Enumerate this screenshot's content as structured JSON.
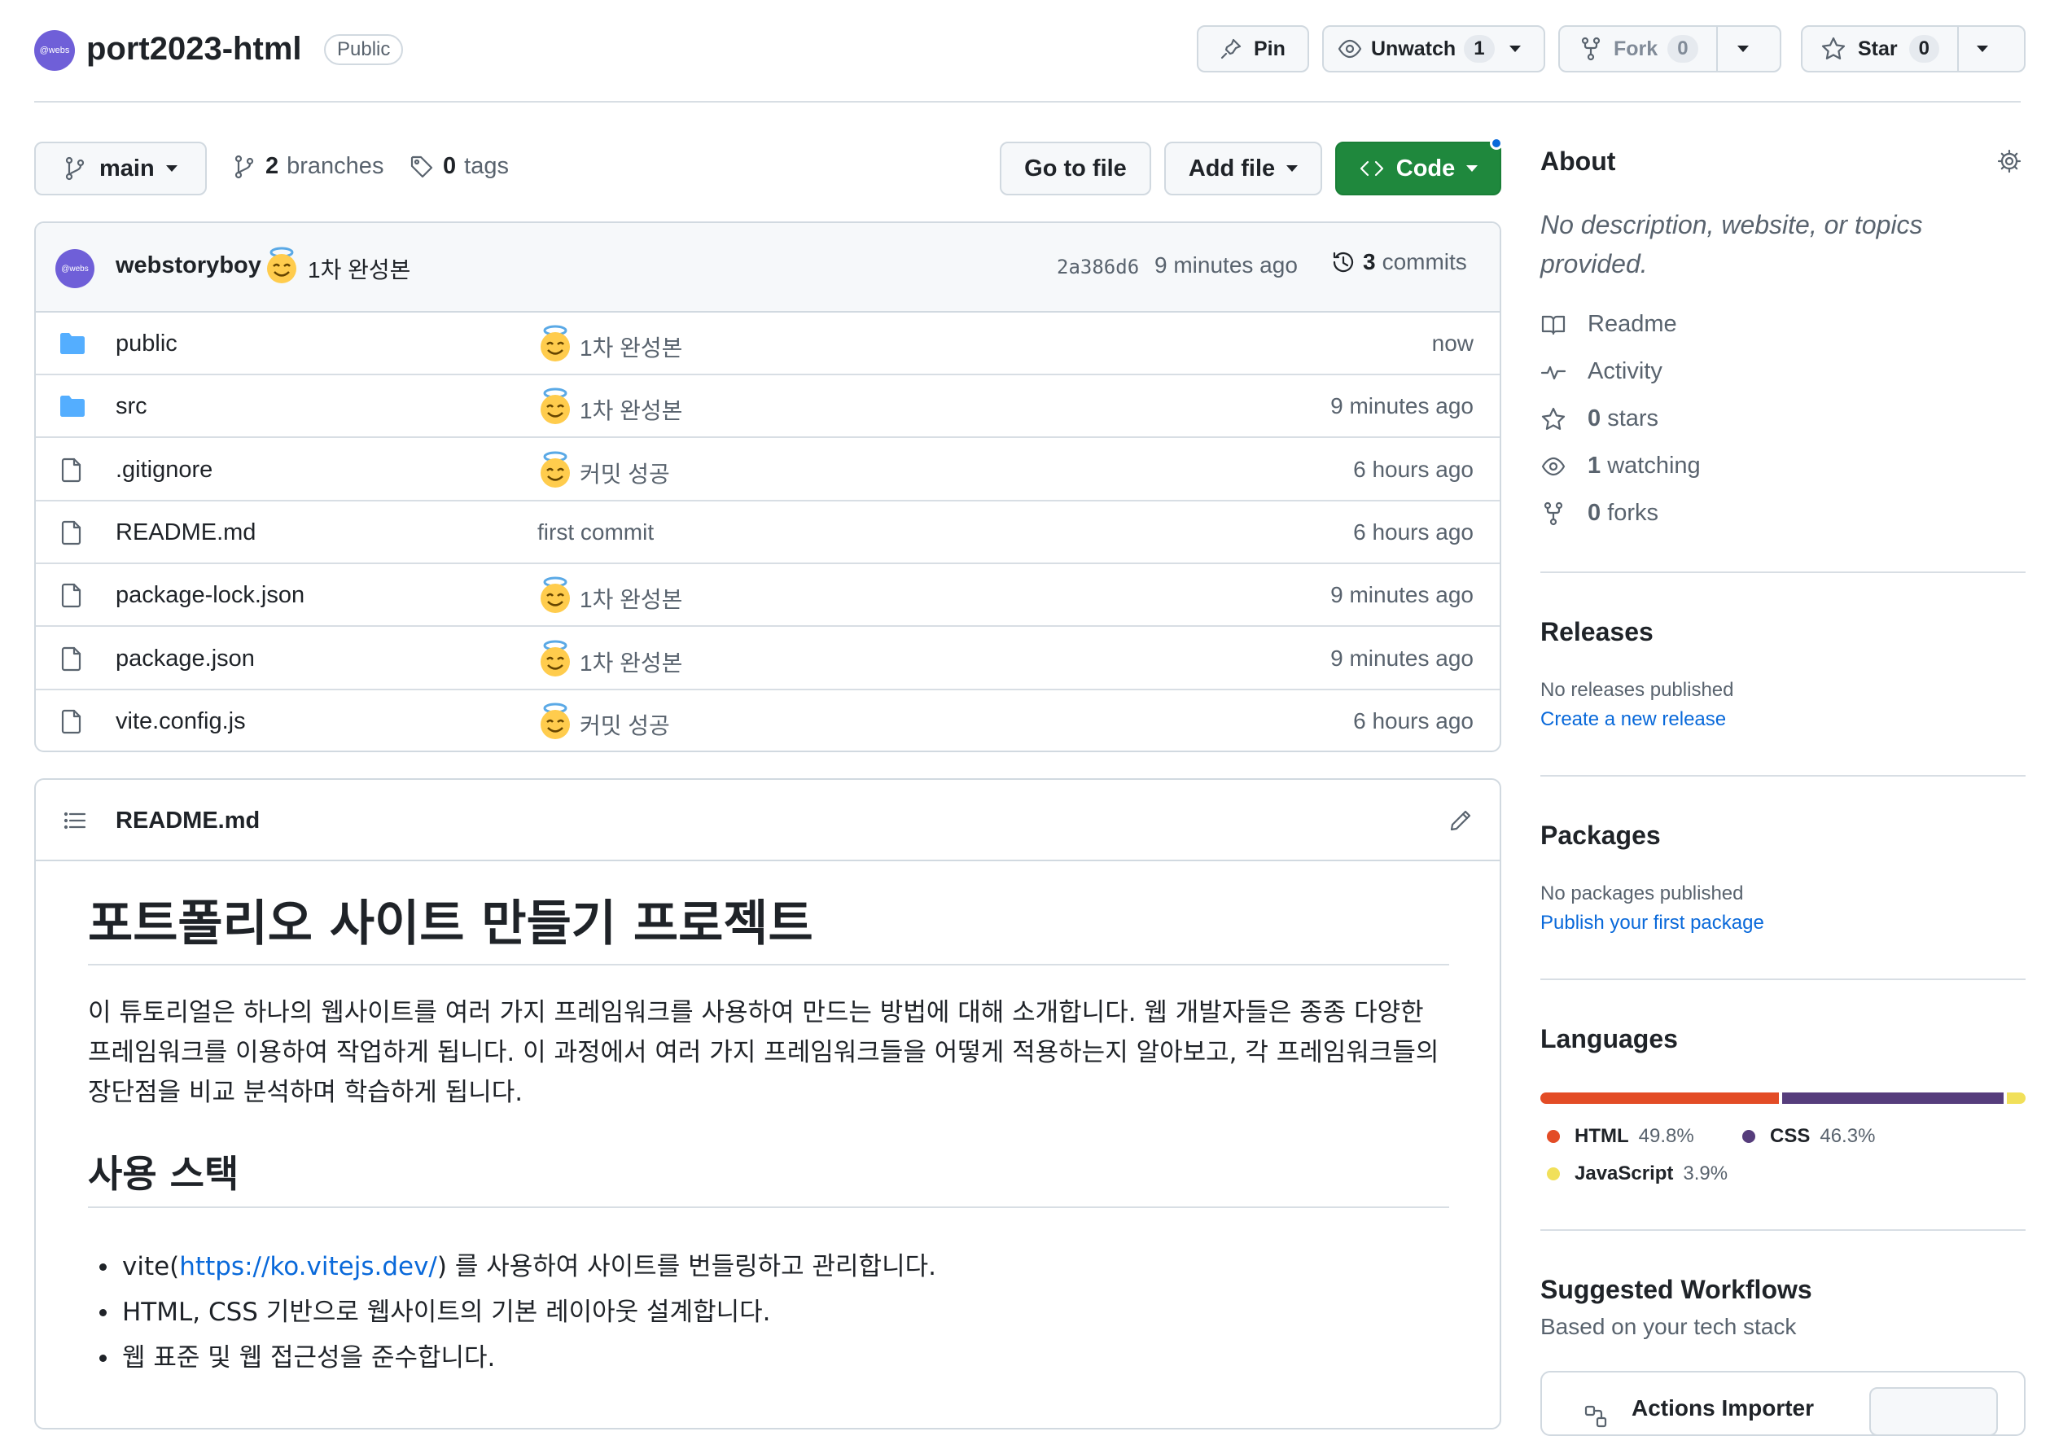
{
  "header": {
    "avatar_text": "@webs",
    "repo_name": "port2023-html",
    "visibility": "Public",
    "pin_label": "Pin",
    "watch_label": "Unwatch",
    "watch_count": "1",
    "fork_label": "Fork",
    "fork_count": "0",
    "star_label": "Star",
    "star_count": "0"
  },
  "toolbar": {
    "branch": "main",
    "branches_count": "2",
    "branches_label": "branches",
    "tags_count": "0",
    "tags_label": "tags",
    "go_to_file": "Go to file",
    "add_file": "Add file",
    "code": "Code"
  },
  "latest_commit": {
    "avatar_text": "@webs",
    "author": "webstoryboy",
    "emoji": "😇",
    "message": "1차 완성본",
    "sha": "2a386d6",
    "time": "9 minutes ago",
    "commits_count": "3",
    "commits_label": "commits"
  },
  "files": [
    {
      "type": "folder",
      "name": "public",
      "emoji": "😇",
      "message": "1차 완성본",
      "time": "now"
    },
    {
      "type": "folder",
      "name": "src",
      "emoji": "😇",
      "message": "1차 완성본",
      "time": "9 minutes ago"
    },
    {
      "type": "file",
      "name": ".gitignore",
      "emoji": "😇",
      "message": "커밋 성공",
      "time": "6 hours ago"
    },
    {
      "type": "file",
      "name": "README.md",
      "emoji": "",
      "message": "first commit",
      "time": "6 hours ago"
    },
    {
      "type": "file",
      "name": "package-lock.json",
      "emoji": "😇",
      "message": "1차 완성본",
      "time": "9 minutes ago"
    },
    {
      "type": "file",
      "name": "package.json",
      "emoji": "😇",
      "message": "1차 완성본",
      "time": "9 minutes ago"
    },
    {
      "type": "file",
      "name": "vite.config.js",
      "emoji": "😇",
      "message": "커밋 성공",
      "time": "6 hours ago"
    }
  ],
  "readme": {
    "file_name": "README.md",
    "h1": "포트폴리오 사이트 만들기 프로젝트",
    "paragraph": "이 튜토리얼은 하나의 웹사이트를 여러 가지 프레임워크를 사용하여 만드는 방법에 대해 소개합니다. 웹 개발자들은 종종 다양한 프레임워크를 이용하여 작업하게 됩니다. 이 과정에서 여러 가지 프레임워크들을 어떻게 적용하는지 알아보고, 각 프레임워크들의 장단점을 비교 분석하며 학습하게 됩니다.",
    "h2": "사용 스택",
    "list": {
      "item1_prefix": "vite(",
      "item1_link": "https://ko.vitejs.dev/",
      "item1_suffix": ") 를 사용하여 사이트를 번들링하고 관리합니다.",
      "item2": "HTML, CSS 기반으로 웹사이트의 기본 레이아웃 설계합니다.",
      "item3": "웹 표준 및 웹 접근성을 준수합니다."
    }
  },
  "sidebar": {
    "about_title": "About",
    "about_desc": "No description, website, or topics provided.",
    "readme": "Readme",
    "activity": "Activity",
    "stars_count": "0",
    "stars_label": "stars",
    "watching_count": "1",
    "watching_label": "watching",
    "forks_count": "0",
    "forks_label": "forks",
    "releases_title": "Releases",
    "releases_empty": "No releases published",
    "releases_link": "Create a new release",
    "packages_title": "Packages",
    "packages_empty": "No packages published",
    "packages_link": "Publish your first package",
    "languages_title": "Languages",
    "languages": [
      {
        "name": "HTML",
        "percent": "49.8%",
        "share": 49.8,
        "color": "#e34c26"
      },
      {
        "name": "CSS",
        "percent": "46.3%",
        "share": 46.3,
        "color": "#563d7c"
      },
      {
        "name": "JavaScript",
        "percent": "3.9%",
        "share": 3.9,
        "color": "#f1e05a"
      }
    ],
    "workflows_title": "Suggested Workflows",
    "workflows_sub": "Based on your tech stack",
    "workflow_card_title": "Actions Importer"
  },
  "colors": {
    "primary_button": "#1f883d",
    "link": "#0969da",
    "border": "#d1d9e0",
    "muted_text": "#59636e"
  }
}
